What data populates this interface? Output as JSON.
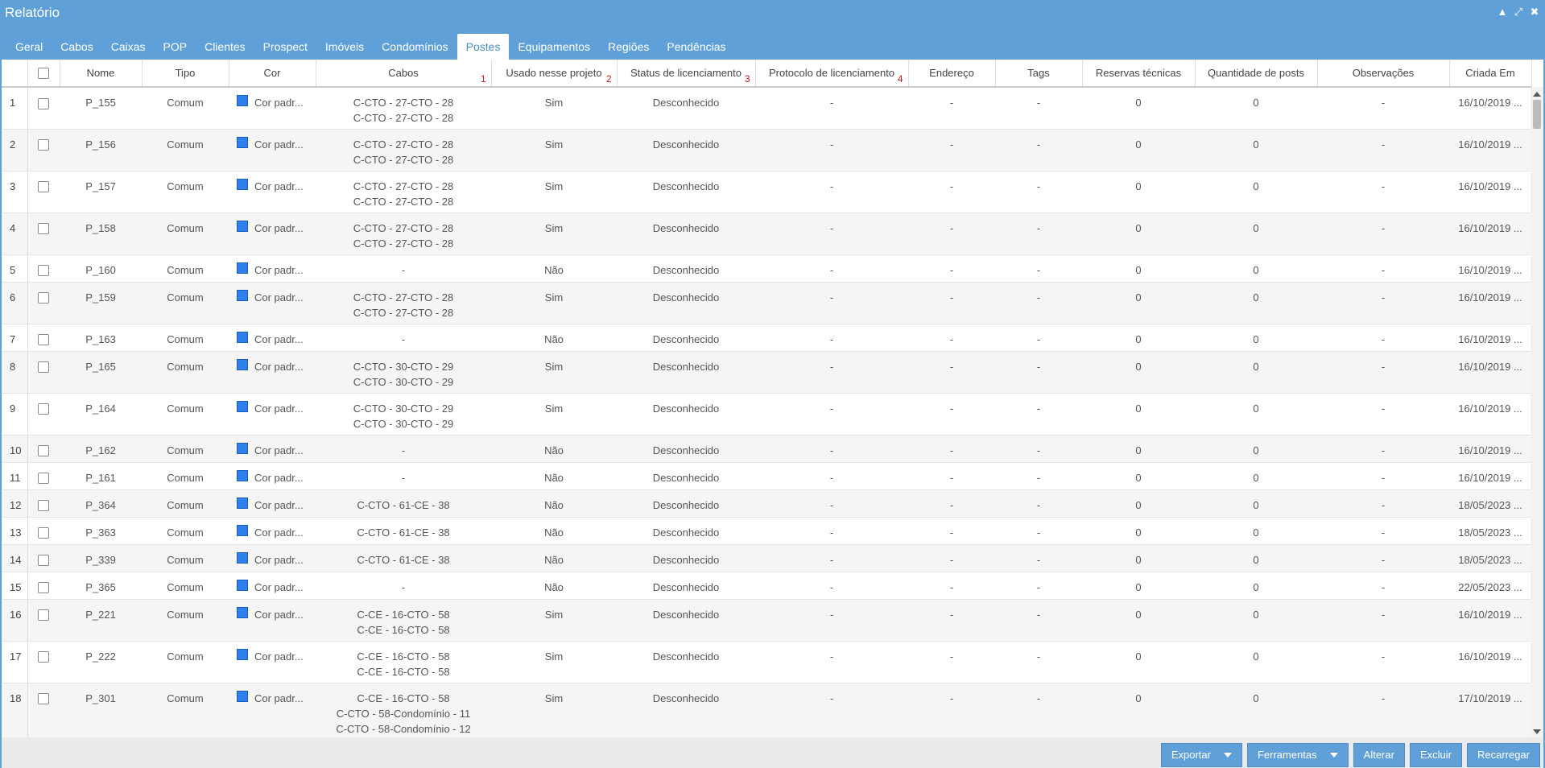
{
  "window": {
    "title": "Relatório",
    "controls": [
      "▲",
      "⤢",
      "✖"
    ]
  },
  "tabs": [
    "Geral",
    "Cabos",
    "Caixas",
    "POP",
    "Clientes",
    "Prospect",
    "Imóveis",
    "Condomínios",
    "Postes",
    "Equipamentos",
    "Regiões",
    "Pendências"
  ],
  "active_tab": "Postes",
  "columns": {
    "nome": "Nome",
    "tipo": "Tipo",
    "cor": "Cor",
    "cabos": "Cabos",
    "usado": "Usado nesse projeto",
    "status": "Status de licenciamento",
    "protocolo": "Protocolo de licenciamento",
    "endereco": "Endereço",
    "tags": "Tags",
    "reservas": "Reservas técnicas",
    "quantidade": "Quantidade de posts",
    "observacoes": "Observações",
    "criada": "Criada Em"
  },
  "column_marks": {
    "cabos": "1",
    "usado": "2",
    "status": "3",
    "protocolo": "4"
  },
  "swatch_color": "#2f80ea",
  "rows": [
    {
      "n": "1",
      "nome": "P_155",
      "tipo": "Comum",
      "cor": "Cor padr...",
      "cabos": [
        "C-CTO - 27-CTO - 28",
        "C-CTO - 27-CTO - 28"
      ],
      "usado": "Sim",
      "status": "Desconhecido",
      "protocolo": "-",
      "endereco": "-",
      "tags": "-",
      "reservas": "0",
      "quantidade": "0",
      "observacoes": "-",
      "criada": "16/10/2019 ..."
    },
    {
      "n": "2",
      "nome": "P_156",
      "tipo": "Comum",
      "cor": "Cor padr...",
      "cabos": [
        "C-CTO - 27-CTO - 28",
        "C-CTO - 27-CTO - 28"
      ],
      "usado": "Sim",
      "status": "Desconhecido",
      "protocolo": "-",
      "endereco": "-",
      "tags": "-",
      "reservas": "0",
      "quantidade": "0",
      "observacoes": "-",
      "criada": "16/10/2019 ..."
    },
    {
      "n": "3",
      "nome": "P_157",
      "tipo": "Comum",
      "cor": "Cor padr...",
      "cabos": [
        "C-CTO - 27-CTO - 28",
        "C-CTO - 27-CTO - 28"
      ],
      "usado": "Sim",
      "status": "Desconhecido",
      "protocolo": "-",
      "endereco": "-",
      "tags": "-",
      "reservas": "0",
      "quantidade": "0",
      "observacoes": "-",
      "criada": "16/10/2019 ..."
    },
    {
      "n": "4",
      "nome": "P_158",
      "tipo": "Comum",
      "cor": "Cor padr...",
      "cabos": [
        "C-CTO - 27-CTO - 28",
        "C-CTO - 27-CTO - 28"
      ],
      "usado": "Sim",
      "status": "Desconhecido",
      "protocolo": "-",
      "endereco": "-",
      "tags": "-",
      "reservas": "0",
      "quantidade": "0",
      "observacoes": "-",
      "criada": "16/10/2019 ..."
    },
    {
      "n": "5",
      "nome": "P_160",
      "tipo": "Comum",
      "cor": "Cor padr...",
      "cabos": [
        "-"
      ],
      "usado": "Não",
      "status": "Desconhecido",
      "protocolo": "-",
      "endereco": "-",
      "tags": "-",
      "reservas": "0",
      "quantidade": "0",
      "observacoes": "-",
      "criada": "16/10/2019 ..."
    },
    {
      "n": "6",
      "nome": "P_159",
      "tipo": "Comum",
      "cor": "Cor padr...",
      "cabos": [
        "C-CTO - 27-CTO - 28",
        "C-CTO - 27-CTO - 28"
      ],
      "usado": "Sim",
      "status": "Desconhecido",
      "protocolo": "-",
      "endereco": "-",
      "tags": "-",
      "reservas": "0",
      "quantidade": "0",
      "observacoes": "-",
      "criada": "16/10/2019 ..."
    },
    {
      "n": "7",
      "nome": "P_163",
      "tipo": "Comum",
      "cor": "Cor padr...",
      "cabos": [
        "-"
      ],
      "usado": "Não",
      "status": "Desconhecido",
      "protocolo": "-",
      "endereco": "-",
      "tags": "-",
      "reservas": "0",
      "quantidade": "0",
      "observacoes": "-",
      "criada": "16/10/2019 ..."
    },
    {
      "n": "8",
      "nome": "P_165",
      "tipo": "Comum",
      "cor": "Cor padr...",
      "cabos": [
        "C-CTO - 30-CTO - 29",
        "C-CTO - 30-CTO - 29"
      ],
      "usado": "Sim",
      "status": "Desconhecido",
      "protocolo": "-",
      "endereco": "-",
      "tags": "-",
      "reservas": "0",
      "quantidade": "0",
      "observacoes": "-",
      "criada": "16/10/2019 ..."
    },
    {
      "n": "9",
      "nome": "P_164",
      "tipo": "Comum",
      "cor": "Cor padr...",
      "cabos": [
        "C-CTO - 30-CTO - 29",
        "C-CTO - 30-CTO - 29"
      ],
      "usado": "Sim",
      "status": "Desconhecido",
      "protocolo": "-",
      "endereco": "-",
      "tags": "-",
      "reservas": "0",
      "quantidade": "0",
      "observacoes": "-",
      "criada": "16/10/2019 ..."
    },
    {
      "n": "10",
      "nome": "P_162",
      "tipo": "Comum",
      "cor": "Cor padr...",
      "cabos": [
        "-"
      ],
      "usado": "Não",
      "status": "Desconhecido",
      "protocolo": "-",
      "endereco": "-",
      "tags": "-",
      "reservas": "0",
      "quantidade": "0",
      "observacoes": "-",
      "criada": "16/10/2019 ..."
    },
    {
      "n": "11",
      "nome": "P_161",
      "tipo": "Comum",
      "cor": "Cor padr...",
      "cabos": [
        "-"
      ],
      "usado": "Não",
      "status": "Desconhecido",
      "protocolo": "-",
      "endereco": "-",
      "tags": "-",
      "reservas": "0",
      "quantidade": "0",
      "observacoes": "-",
      "criada": "16/10/2019 ..."
    },
    {
      "n": "12",
      "nome": "P_364",
      "tipo": "Comum",
      "cor": "Cor padr...",
      "cabos": [
        "C-CTO - 61-CE - 38"
      ],
      "usado": "Não",
      "status": "Desconhecido",
      "protocolo": "-",
      "endereco": "-",
      "tags": "-",
      "reservas": "0",
      "quantidade": "0",
      "observacoes": "-",
      "criada": "18/05/2023 ..."
    },
    {
      "n": "13",
      "nome": "P_363",
      "tipo": "Comum",
      "cor": "Cor padr...",
      "cabos": [
        "C-CTO - 61-CE - 38"
      ],
      "usado": "Não",
      "status": "Desconhecido",
      "protocolo": "-",
      "endereco": "-",
      "tags": "-",
      "reservas": "0",
      "quantidade": "0",
      "observacoes": "-",
      "criada": "18/05/2023 ..."
    },
    {
      "n": "14",
      "nome": "P_339",
      "tipo": "Comum",
      "cor": "Cor padr...",
      "cabos": [
        "C-CTO - 61-CE - 38"
      ],
      "usado": "Não",
      "status": "Desconhecido",
      "protocolo": "-",
      "endereco": "-",
      "tags": "-",
      "reservas": "0",
      "quantidade": "0",
      "observacoes": "-",
      "criada": "18/05/2023 ..."
    },
    {
      "n": "15",
      "nome": "P_365",
      "tipo": "Comum",
      "cor": "Cor padr...",
      "cabos": [
        "-"
      ],
      "usado": "Não",
      "status": "Desconhecido",
      "protocolo": "-",
      "endereco": "-",
      "tags": "-",
      "reservas": "0",
      "quantidade": "0",
      "observacoes": "-",
      "criada": "22/05/2023 ..."
    },
    {
      "n": "16",
      "nome": "P_221",
      "tipo": "Comum",
      "cor": "Cor padr...",
      "cabos": [
        "C-CE - 16-CTO - 58",
        "C-CE - 16-CTO - 58"
      ],
      "usado": "Sim",
      "status": "Desconhecido",
      "protocolo": "-",
      "endereco": "-",
      "tags": "-",
      "reservas": "0",
      "quantidade": "0",
      "observacoes": "-",
      "criada": "16/10/2019 ..."
    },
    {
      "n": "17",
      "nome": "P_222",
      "tipo": "Comum",
      "cor": "Cor padr...",
      "cabos": [
        "C-CE - 16-CTO - 58",
        "C-CE - 16-CTO - 58"
      ],
      "usado": "Sim",
      "status": "Desconhecido",
      "protocolo": "-",
      "endereco": "-",
      "tags": "-",
      "reservas": "0",
      "quantidade": "0",
      "observacoes": "-",
      "criada": "16/10/2019 ..."
    },
    {
      "n": "18",
      "nome": "P_301",
      "tipo": "Comum",
      "cor": "Cor padr...",
      "cabos": [
        "C-CE - 16-CTO - 58",
        "C-CTO - 58-Condomínio - 11",
        "C-CTO - 58-Condomínio - 12"
      ],
      "usado": "Sim",
      "status": "Desconhecido",
      "protocolo": "-",
      "endereco": "-",
      "tags": "-",
      "reservas": "0",
      "quantidade": "0",
      "observacoes": "-",
      "criada": "17/10/2019 ..."
    }
  ],
  "buttons": {
    "exportar": "Exportar",
    "ferramentas": "Ferramentas",
    "alterar": "Alterar",
    "excluir": "Excluir",
    "recarregar": "Recarregar"
  }
}
